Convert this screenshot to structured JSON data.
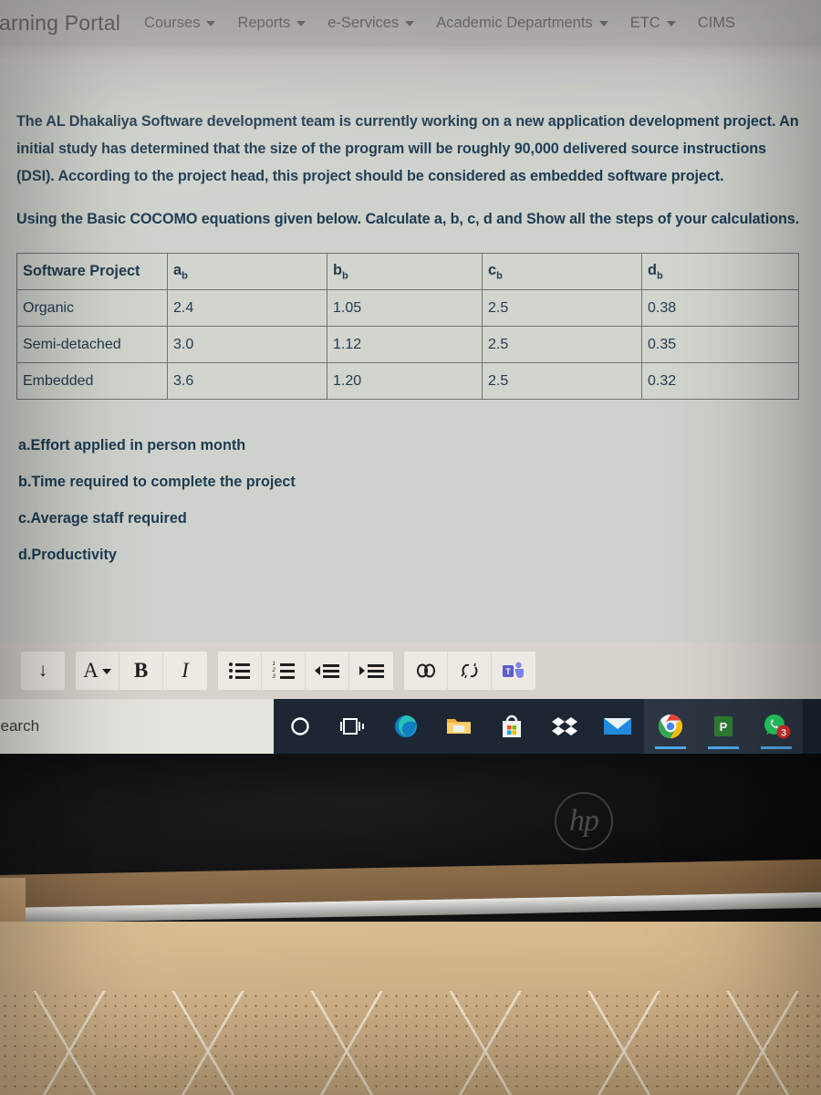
{
  "navbar": {
    "brand": "earning Portal",
    "items": [
      {
        "label": "Courses",
        "caret": "chevron-down-icon"
      },
      {
        "label": "Reports",
        "caret": "chevron-down-icon"
      },
      {
        "label": "e-Services",
        "caret": "chevron-down-icon"
      },
      {
        "label": "Academic Departments",
        "caret": "chevron-down-icon"
      },
      {
        "label": "ETC",
        "caret": "chevron-down-icon"
      },
      {
        "label": "CIMS",
        "caret": "none"
      }
    ]
  },
  "question": {
    "paragraph1": "The AL Dhakaliya Software development team is currently working on a new application development project. An initial study has determined that the size of the program will be roughly 90,000 delivered source instructions (DSI). According to the project head, this project should be considered as embedded software project.",
    "paragraph2": "Using the Basic COCOMO equations given below. Calculate a, b, c, d and  Show all the steps of your calculations.",
    "subquestions": [
      "a.Effort applied in person month",
      "b.Time required to complete the project",
      "c.Average staff required",
      "d.Productivity"
    ]
  },
  "table": {
    "headers": [
      "Software Project",
      "ab",
      "bb",
      "cb",
      "db"
    ],
    "header_bases": [
      "Software Project",
      "a",
      "b",
      "c",
      "d"
    ],
    "header_sub": "b",
    "rows": [
      [
        "Organic",
        "2.4",
        "1.05",
        "2.5",
        "0.38"
      ],
      [
        "Semi-detached",
        "3.0",
        "1.12",
        "2.5",
        "0.35"
      ],
      [
        "Embedded",
        "3.6",
        "1.20",
        "2.5",
        "0.32"
      ]
    ]
  },
  "toolbar": {
    "groups": [
      [
        {
          "name": "more-options-icon",
          "glyph": "↓"
        }
      ],
      [
        {
          "name": "font-color-icon",
          "glyph": "A"
        },
        {
          "name": "bold-icon",
          "glyph": "B"
        },
        {
          "name": "italic-icon",
          "glyph": "I"
        }
      ],
      [
        {
          "name": "bullet-list-icon",
          "glyph": ""
        },
        {
          "name": "numbered-list-icon",
          "glyph": ""
        },
        {
          "name": "decrease-indent-icon",
          "glyph": ""
        },
        {
          "name": "increase-indent-icon",
          "glyph": ""
        }
      ],
      [
        {
          "name": "insert-link-icon",
          "glyph": "⚭"
        },
        {
          "name": "remove-link-icon",
          "glyph": "⚮"
        },
        {
          "name": "microsoft-teams-icon",
          "glyph": "T"
        }
      ]
    ]
  },
  "taskbar": {
    "search_text": "search",
    "icons": [
      {
        "name": "cortana-icon",
        "label": "Cortana"
      },
      {
        "name": "task-view-icon",
        "label": "Task View"
      },
      {
        "name": "microsoft-edge-icon",
        "label": "Microsoft Edge"
      },
      {
        "name": "file-explorer-icon",
        "label": "File Explorer"
      },
      {
        "name": "microsoft-store-icon",
        "label": "Microsoft Store"
      },
      {
        "name": "dropbox-icon",
        "label": "Dropbox"
      },
      {
        "name": "mail-icon",
        "label": "Mail"
      },
      {
        "name": "google-chrome-icon",
        "label": "Google Chrome"
      },
      {
        "name": "powerpoint-icon",
        "label": "PowerPoint"
      },
      {
        "name": "whatsapp-icon",
        "label": "WhatsApp",
        "badge": "3"
      }
    ]
  },
  "hardware": {
    "laptop_brand": "hp"
  },
  "colors": {
    "text_blue": "#1d3b52",
    "nav_text": "#6e6a72",
    "content_bg": "#cfd2cc",
    "taskbar_bg": "#1c2733",
    "badge_red": "#e02b2b",
    "teams_purple": "#5b5fc7"
  }
}
